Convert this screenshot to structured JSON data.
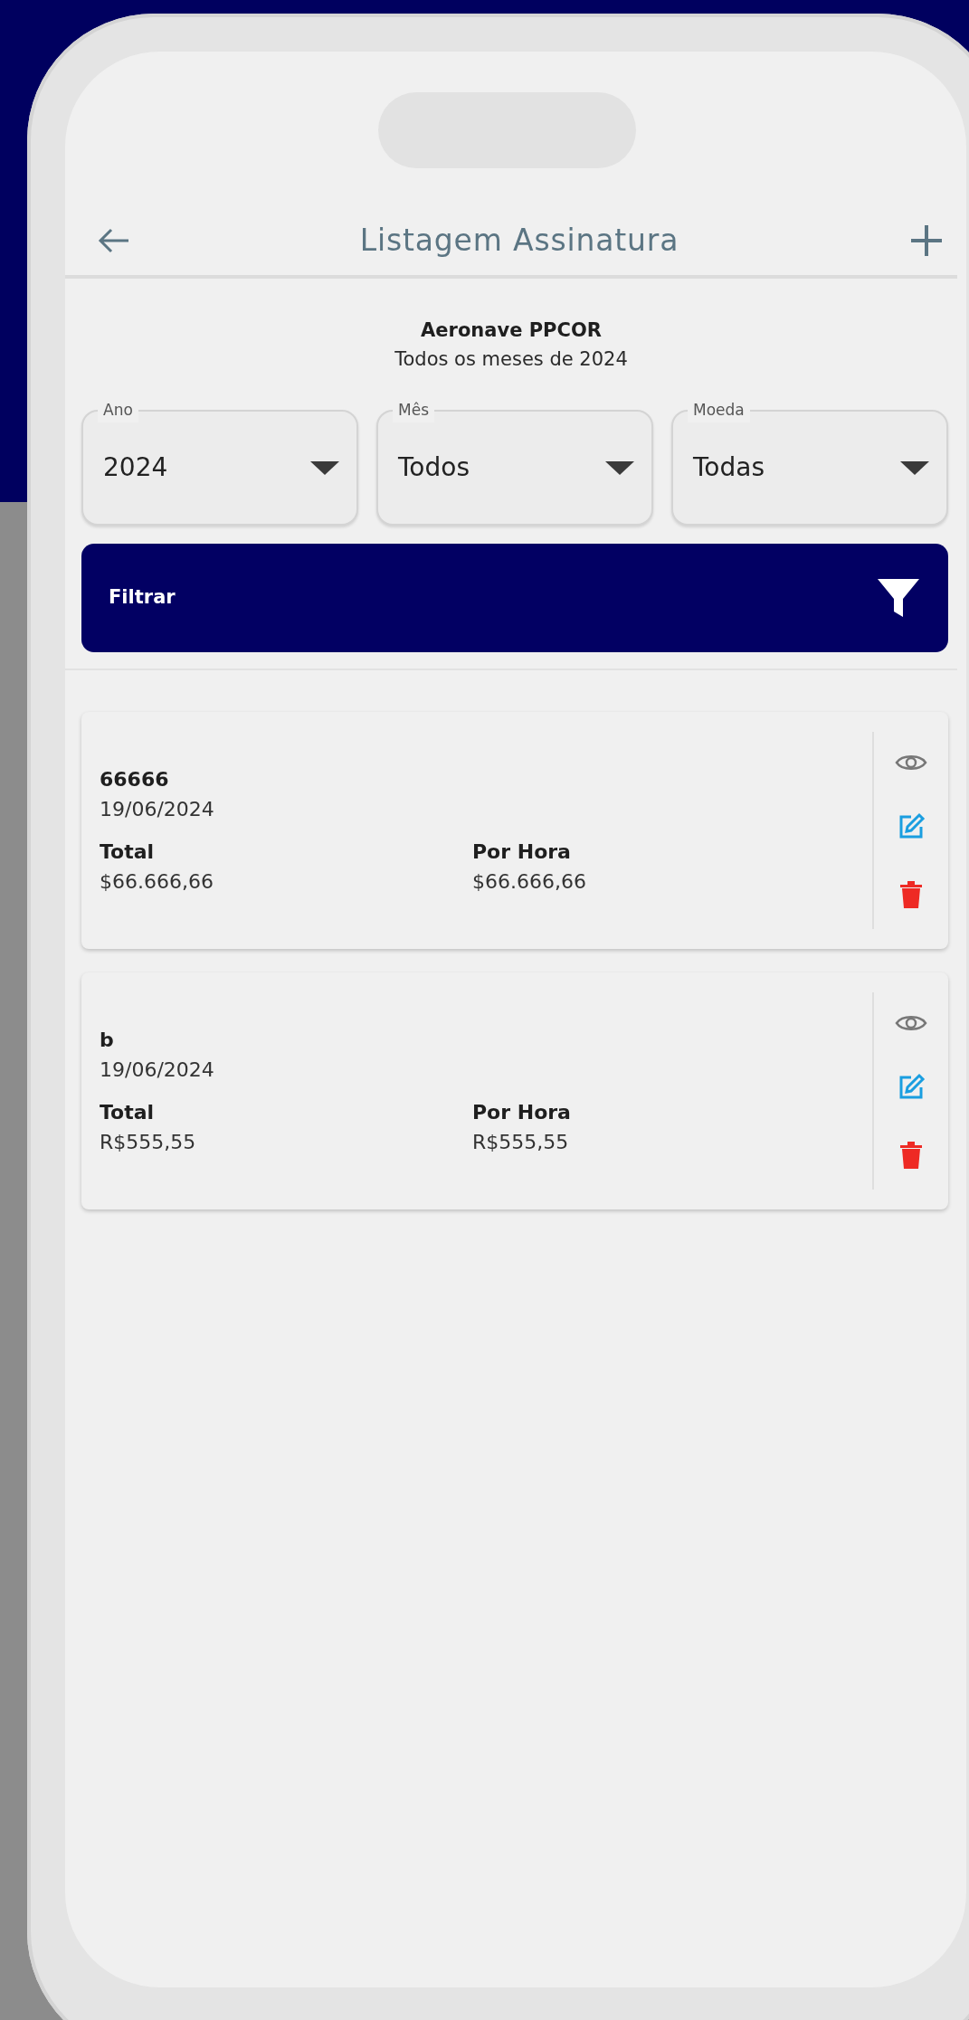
{
  "header": {
    "title": "Listagem Assinatura"
  },
  "summary": {
    "aircraft": "Aeronave PPCOR",
    "period": "Todos os meses de 2024"
  },
  "filters": [
    {
      "label": "Ano",
      "value": "2024"
    },
    {
      "label": "Mês",
      "value": "Todos"
    },
    {
      "label": "Moeda",
      "value": "Todas"
    }
  ],
  "filter_button": {
    "label": "Filtrar"
  },
  "records": [
    {
      "name": "66666",
      "date": "19/06/2024",
      "total_label": "Total",
      "total": "$66.666,66",
      "per_hour_label": "Por Hora",
      "per_hour": "$66.666,66"
    },
    {
      "name": "b",
      "date": "19/06/2024",
      "total_label": "Total",
      "total": "R$555,55",
      "per_hour_label": "Por Hora",
      "per_hour": "R$555,55"
    }
  ]
}
